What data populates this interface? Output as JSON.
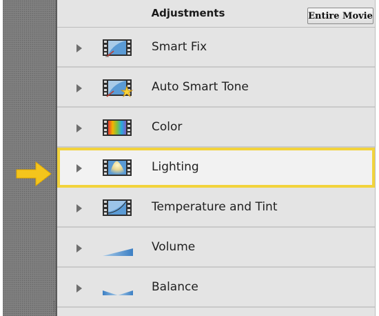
{
  "header": {
    "title": "Adjustments",
    "scope_button": "Entire Movie"
  },
  "adjustments": [
    {
      "label": "Smart Fix",
      "icon": "smart-fix-icon"
    },
    {
      "label": "Auto Smart Tone",
      "icon": "auto-smart-tone-icon"
    },
    {
      "label": "Color",
      "icon": "color-filmstrip-icon"
    },
    {
      "label": "Lighting",
      "icon": "lighting-filmstrip-icon",
      "highlighted": true
    },
    {
      "label": "Temperature and Tint",
      "icon": "temperature-tint-icon"
    },
    {
      "label": "Volume",
      "icon": "volume-ramp-icon"
    },
    {
      "label": "Balance",
      "icon": "balance-icon"
    }
  ],
  "colors": {
    "highlight_border": "#f2d33c",
    "pointer_arrow": "#f4c51c",
    "icon_blue": "#5b9bd5"
  }
}
